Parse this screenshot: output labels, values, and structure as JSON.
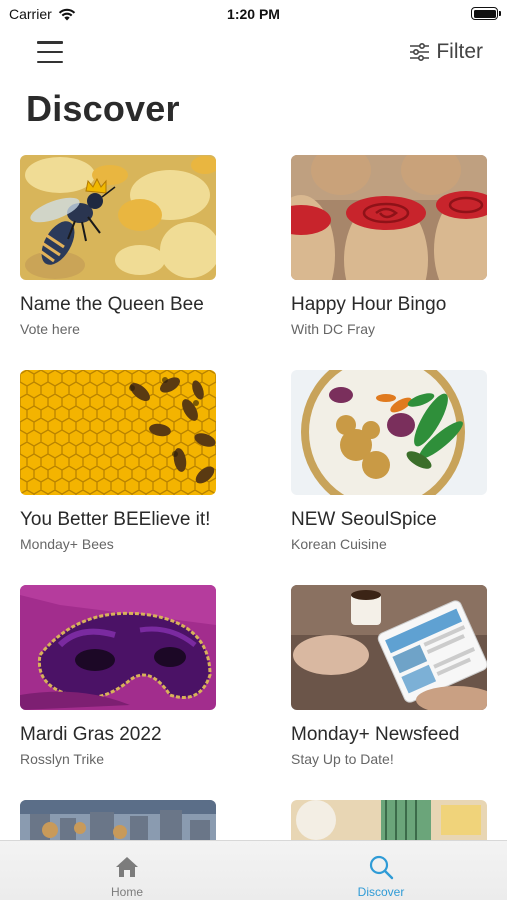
{
  "status_bar": {
    "carrier": "Carrier",
    "time": "1:20 PM"
  },
  "nav": {
    "filter_label": "Filter",
    "menu_icon": "hamburger-menu-icon",
    "filter_icon": "sliders-icon"
  },
  "page": {
    "title": "Discover"
  },
  "cards": [
    {
      "title": "Name the Queen Bee",
      "subtitle": "Vote here"
    },
    {
      "title": "Happy Hour Bingo",
      "subtitle": "With DC Fray"
    },
    {
      "title": "You Better BEElieve it!",
      "subtitle": "Monday+ Bees"
    },
    {
      "title": "NEW SeoulSpice",
      "subtitle": "Korean Cuisine"
    },
    {
      "title": "Mardi Gras 2022",
      "subtitle": "Rosslyn Trike"
    },
    {
      "title": "Monday+ Newsfeed",
      "subtitle": "Stay Up to Date!"
    }
  ],
  "tab_bar": {
    "tabs": [
      {
        "label": "Home",
        "icon": "house-icon",
        "selected": false
      },
      {
        "label": "Discover",
        "icon": "magnifier-icon",
        "selected": true
      }
    ]
  },
  "colors": {
    "accent": "#2f9bd6",
    "inactive_tab": "#7c7c7c"
  }
}
